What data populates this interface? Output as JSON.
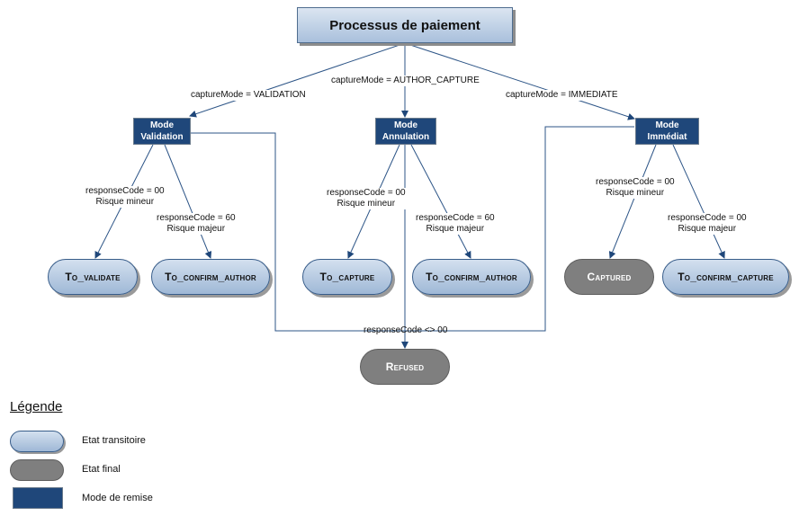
{
  "title": "Processus de paiement",
  "capture_modes": [
    {
      "id": "validation",
      "edge_label": "captureMode = VALIDATION",
      "box_line1": "Mode",
      "box_line2": "Validation"
    },
    {
      "id": "annulation",
      "edge_label": "captureMode = AUTHOR_CAPTURE",
      "box_line1": "Mode",
      "box_line2": "Annulation"
    },
    {
      "id": "immediat",
      "edge_label": "captureMode = IMMEDIATE",
      "box_line1": "Mode",
      "box_line2": "Immédiat"
    }
  ],
  "transitions": [
    {
      "from": "validation",
      "to": "To_validate",
      "line1": "responseCode = 00",
      "line2": "Risque mineur"
    },
    {
      "from": "validation",
      "to": "To_confirm_author",
      "line1": "responseCode = 60",
      "line2": "Risque majeur"
    },
    {
      "from": "annulation",
      "to": "To_capture",
      "line1": "responseCode = 00",
      "line2": "Risque mineur"
    },
    {
      "from": "annulation",
      "to": "To_confirm_author",
      "line1": "responseCode = 60",
      "line2": "Risque majeur"
    },
    {
      "from": "immediat",
      "to": "Captured",
      "line1": "responseCode = 00",
      "line2": "Risque mineur"
    },
    {
      "from": "immediat",
      "to": "To_confirm_capture",
      "line1": "responseCode = 00",
      "line2": "Risque majeur"
    }
  ],
  "states": [
    {
      "label": "To_validate",
      "kind": "transitoire"
    },
    {
      "label": "To_confirm_author",
      "kind": "transitoire"
    },
    {
      "label": "To_capture",
      "kind": "transitoire"
    },
    {
      "label": "To_confirm_author",
      "kind": "transitoire"
    },
    {
      "label": "Captured",
      "kind": "final"
    },
    {
      "label": "To_confirm_capture",
      "kind": "transitoire"
    },
    {
      "label": "Refused",
      "kind": "final"
    }
  ],
  "refused_edge_label": "responseCode <> 00",
  "legend": {
    "title": "Légende",
    "items": [
      {
        "label": "Etat transitoire"
      },
      {
        "label": "Etat final"
      },
      {
        "label": "Mode de remise"
      }
    ]
  },
  "colors": {
    "mode_box": "#1f477a",
    "line": "#1f477a",
    "final_state": "#7f7f7f",
    "transit_state_top": "#d3e0ef",
    "transit_state_bottom": "#9fb8d6"
  }
}
